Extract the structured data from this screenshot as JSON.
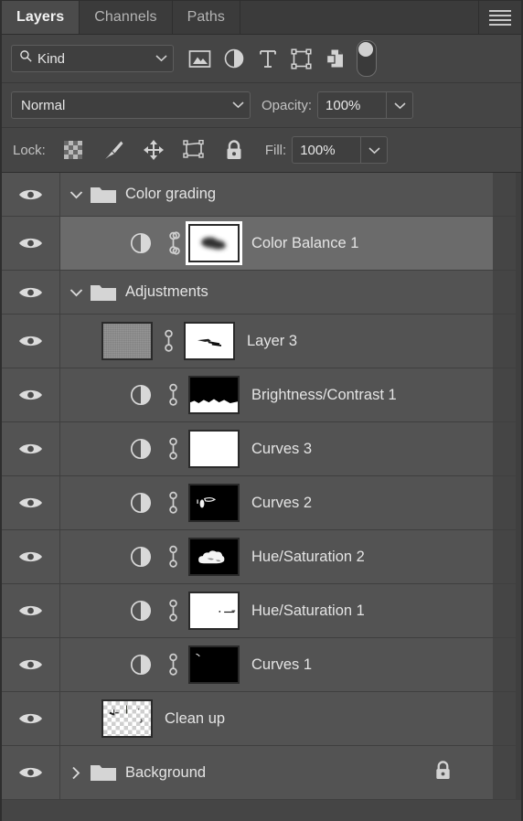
{
  "panel": {
    "tabs": [
      {
        "label": "Layers",
        "active": true
      },
      {
        "label": "Channels",
        "active": false
      },
      {
        "label": "Paths",
        "active": false
      }
    ],
    "menu_icon": "hamburger-menu-icon"
  },
  "filter": {
    "search_icon": "search-icon",
    "kind_label": "Kind",
    "dropdown_icon": "chevron-down-icon",
    "icons": [
      {
        "name": "pixel-layer-filter-icon"
      },
      {
        "name": "adjustment-layer-filter-icon"
      },
      {
        "name": "type-layer-filter-icon"
      },
      {
        "name": "shape-layer-filter-icon"
      },
      {
        "name": "smart-object-filter-icon"
      }
    ],
    "toggle": {
      "name": "filter-enable-toggle",
      "state": "on"
    }
  },
  "blend": {
    "mode": "Normal",
    "opacity_label": "Opacity:",
    "opacity_value": "100%",
    "dropdown_icon": "chevron-down-icon"
  },
  "lock": {
    "label": "Lock:",
    "icons": [
      {
        "name": "lock-transparent-pixels-icon"
      },
      {
        "name": "lock-image-pixels-icon"
      },
      {
        "name": "lock-position-icon"
      },
      {
        "name": "lock-artboard-nesting-icon"
      },
      {
        "name": "lock-all-icon"
      }
    ],
    "fill_label": "Fill:",
    "fill_value": "100%"
  },
  "layers": [
    {
      "name": "Color grading",
      "type": "group",
      "visible": true,
      "expanded": true,
      "selected": false,
      "indent": 0
    },
    {
      "name": "Color Balance 1",
      "type": "adjustment",
      "visible": true,
      "selected": true,
      "indent": 1,
      "mask": "blurred-dark-blob-on-white",
      "linked": true
    },
    {
      "name": "Adjustments",
      "type": "group",
      "visible": true,
      "expanded": true,
      "selected": false,
      "indent": 0
    },
    {
      "name": "Layer 3",
      "type": "pixel",
      "visible": true,
      "selected": false,
      "indent": 1,
      "mask": "small-dark-streak-on-white",
      "linked": true
    },
    {
      "name": "Brightness/Contrast 1",
      "type": "adjustment",
      "visible": true,
      "selected": false,
      "indent": 1,
      "mask": "black-with-white-bottom-landscape",
      "linked": true
    },
    {
      "name": "Curves 3",
      "type": "adjustment",
      "visible": true,
      "selected": false,
      "indent": 1,
      "mask": "all-white",
      "linked": true
    },
    {
      "name": "Curves 2",
      "type": "adjustment",
      "visible": true,
      "selected": false,
      "indent": 1,
      "mask": "black-with-small-white-marks",
      "linked": true
    },
    {
      "name": "Hue/Saturation 2",
      "type": "adjustment",
      "visible": true,
      "selected": false,
      "indent": 1,
      "mask": "black-with-white-cloud-blob",
      "linked": true
    },
    {
      "name": "Hue/Saturation 1",
      "type": "adjustment",
      "visible": true,
      "selected": false,
      "indent": 1,
      "mask": "white-with-small-dark-marks",
      "linked": true
    },
    {
      "name": "Curves 1",
      "type": "adjustment",
      "visible": true,
      "selected": false,
      "indent": 1,
      "mask": "black-with-tiny-white-tick",
      "linked": true
    },
    {
      "name": "Clean up",
      "type": "pixel",
      "visible": true,
      "selected": false,
      "indent": 1,
      "thumbnail": "transparent-checkerboard-with-marks"
    },
    {
      "name": "Background",
      "type": "group",
      "visible": true,
      "expanded": false,
      "selected": false,
      "indent": 0,
      "locked": true
    }
  ],
  "colors": {
    "panel_bg": "#454545",
    "tabbar_bg": "#3b3b3b",
    "tab_active_bg": "#4b4b4b",
    "row_bg": "#535353",
    "row_selected_bg": "#6b6b6b",
    "text": "#e4e4e4",
    "text_dim": "#b4b4b4",
    "field_bg": "#3f3f3f",
    "field_border": "#5d5d5d"
  }
}
